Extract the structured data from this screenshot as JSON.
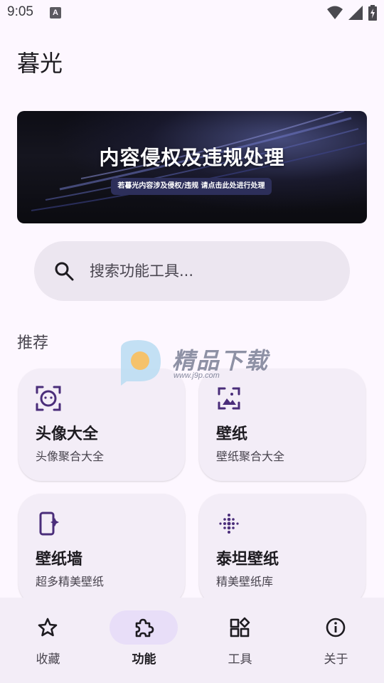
{
  "status_bar": {
    "time": "9:05",
    "app_icon_letter": "A"
  },
  "header": {
    "title": "暮光"
  },
  "banner": {
    "title": "内容侵权及违规处理",
    "subtitle": "若暮光内容涉及侵权/违规 请点击此处进行处理"
  },
  "search": {
    "placeholder": "搜索功能工具..."
  },
  "section": {
    "title": "推荐"
  },
  "cards": [
    {
      "title": "头像大全",
      "subtitle": "头像聚合大全",
      "icon": "face-frame-icon"
    },
    {
      "title": "壁纸",
      "subtitle": "壁纸聚合大全",
      "icon": "image-frame-icon"
    },
    {
      "title": "壁纸墙",
      "subtitle": "超多精美壁纸",
      "icon": "phone-sparkle-icon"
    },
    {
      "title": "泰坦壁纸",
      "subtitle": "精美壁纸库",
      "icon": "dots-grid-icon"
    }
  ],
  "watermark": {
    "text": "精品下载",
    "url": "www.j9p.com"
  },
  "nav": {
    "active_index": 1,
    "items": [
      {
        "label": "收藏",
        "icon": "star-icon"
      },
      {
        "label": "功能",
        "icon": "puzzle-icon"
      },
      {
        "label": "工具",
        "icon": "widgets-icon"
      },
      {
        "label": "关于",
        "icon": "info-icon"
      }
    ]
  },
  "colors": {
    "background": "#fdf7ff",
    "accent": "#4a2d7a",
    "card": "#f3edf7",
    "active_pill": "#e8def8"
  }
}
